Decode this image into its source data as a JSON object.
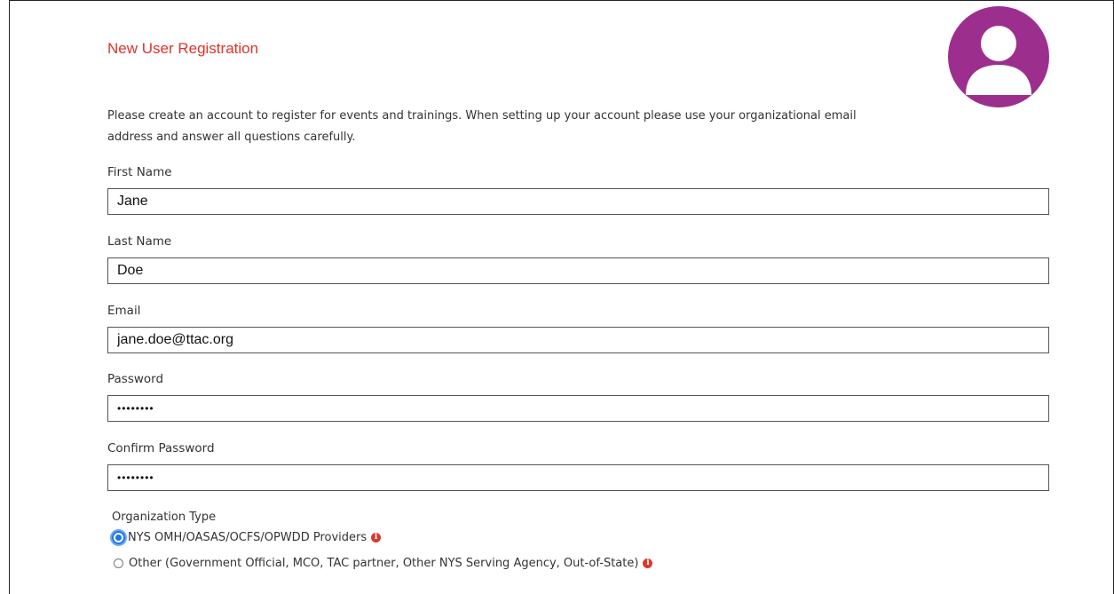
{
  "form": {
    "title": "New User Registration",
    "intro": "Please create an account to register for events and trainings. When setting up your account please use your organizational email address and answer all questions carefully.",
    "fields": {
      "first_name": {
        "label": "First Name",
        "value": "Jane"
      },
      "last_name": {
        "label": "Last Name",
        "value": "Doe"
      },
      "email": {
        "label": "Email",
        "value": "jane.doe@ttac.org"
      },
      "password": {
        "label": "Password",
        "value": "••••••••"
      },
      "confirm_password": {
        "label": "Confirm Password",
        "value": "••••••••"
      }
    },
    "organization_type": {
      "label": "Organization Type",
      "options": [
        {
          "label": "NYS OMH/OASAS/OCFS/OPWDD Providers",
          "selected": true,
          "info_icon": "info-icon"
        },
        {
          "label": "Other (Government Official, MCO, TAC partner, Other NYS Serving Agency, Out-of-State)",
          "selected": false,
          "info_icon": "info-icon"
        }
      ]
    }
  },
  "avatar": {
    "icon": "user-avatar-icon",
    "color": "#9c2f8e"
  },
  "colors": {
    "title": "#e5302a",
    "info_icon": "#d9382e",
    "radio_accent": "#1a73e8"
  }
}
